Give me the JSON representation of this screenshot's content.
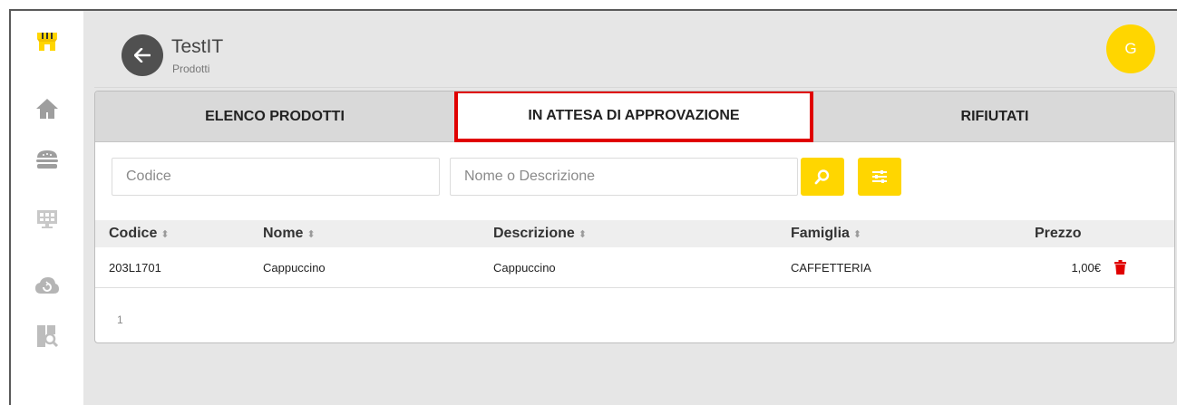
{
  "colors": {
    "accent": "#ffd600",
    "highlight": "#e00000",
    "delete": "#e00000",
    "dark": "#505050"
  },
  "sidebar": {
    "items": [
      {
        "icon": "shop-icon"
      },
      {
        "icon": "home-icon"
      },
      {
        "icon": "burger-icon"
      },
      {
        "icon": "monitor-icon"
      },
      {
        "icon": "cloud-sync-icon"
      },
      {
        "icon": "search-doc-icon"
      }
    ]
  },
  "header": {
    "title": "TestIT",
    "subtitle": "Prodotti",
    "avatar_initial": "G"
  },
  "tabs": [
    {
      "label": "ELENCO PRODOTTI"
    },
    {
      "label": "IN ATTESA DI APPROVAZIONE",
      "active": true
    },
    {
      "label": "RIFIUTATI"
    }
  ],
  "filters": {
    "code_placeholder": "Codice",
    "name_placeholder": "Nome o Descrizione"
  },
  "table": {
    "columns": [
      "Codice",
      "Nome",
      "Descrizione",
      "Famiglia",
      "Prezzo"
    ],
    "rows": [
      {
        "codice": "203L1701",
        "nome": "Cappuccino",
        "descrizione": "Cappuccino",
        "famiglia": "CAFFETTERIA",
        "prezzo": "1,00€"
      }
    ]
  },
  "pagination": {
    "current": "1"
  }
}
